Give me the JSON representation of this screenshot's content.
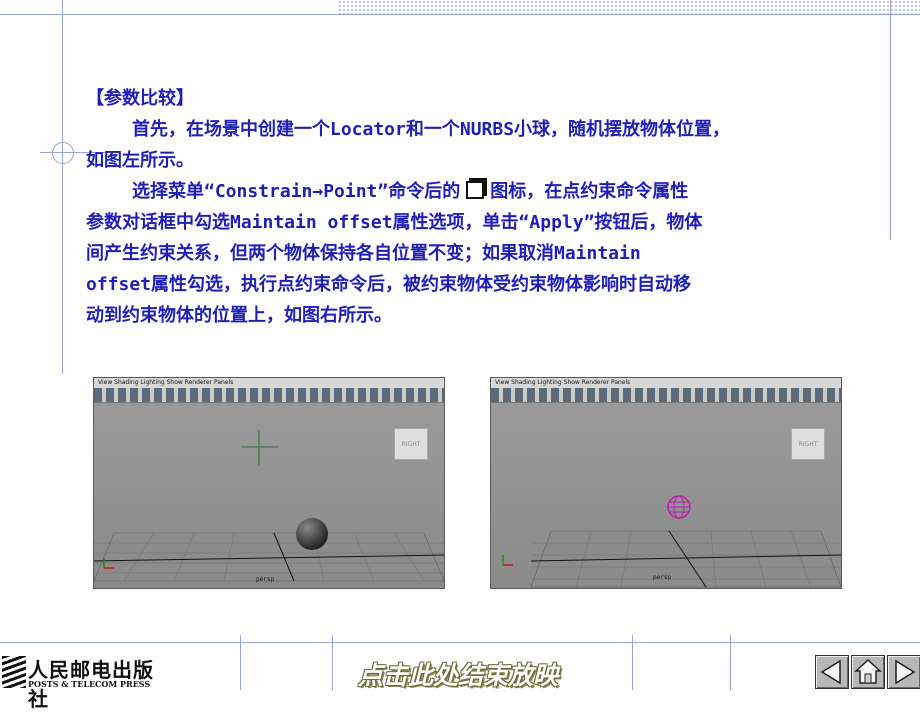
{
  "slide": {
    "heading": "【参数比较】",
    "para1_l1": "首先，在场景中创建一个Locator和一个NURBS小球，随机摆放物体位置，",
    "para1_l2": "如图左所示。",
    "para2_l1a": "选择菜单“Constrain→Point”命令后的",
    "para2_l1b": "图标，在点约束命令属性",
    "para2_l2": "参数对话框中勾选Maintain offset属性选项，单击“Apply”按钮后，物体",
    "para2_l3": "间产生约束关系，但两个物体保持各自位置不变；如果取消Maintain",
    "para2_l4": "offset属性勾选，执行点约束命令后，被约束物体受约束物体影响时自动移",
    "para2_l5": "动到约束物体的位置上，如图右所示。"
  },
  "viewports": {
    "left": {
      "menu": "View  Shading  Lighting  Show  Renderer  Panels",
      "cube_label": "RIGHT",
      "camera": "persp"
    },
    "right": {
      "menu": "View  Shading  Lighting  Show  Renderer  Panels",
      "cube_label": "RIGHT",
      "camera": "persp"
    }
  },
  "footer": {
    "publisher_cn": "人民邮电出版社",
    "publisher_en": "POSTS & TELECOM PRESS",
    "end_show": "点击此处结束放映"
  },
  "icons": [
    "option-box-icon",
    "prev-icon",
    "home-icon",
    "next-icon"
  ],
  "colors": {
    "body_text": "#1f1fb8",
    "decor_lines": "#9aa4d6"
  }
}
